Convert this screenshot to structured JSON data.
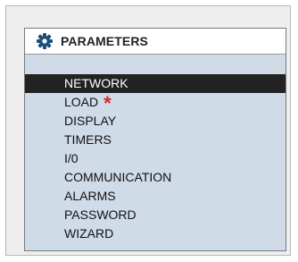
{
  "header": {
    "icon": "gear-icon",
    "title": "PARAMETERS"
  },
  "menu": {
    "items": [
      {
        "label": "NETWORK",
        "selected": true
      },
      {
        "label": "LOAD",
        "marker": "*"
      },
      {
        "label": "DISPLAY"
      },
      {
        "label": "TIMERS"
      },
      {
        "label": "I/0"
      },
      {
        "label": "COMMUNICATION"
      },
      {
        "label": "ALARMS"
      },
      {
        "label": "PASSWORD"
      },
      {
        "label": "WIZARD"
      }
    ]
  },
  "colors": {
    "panel_bg": "#cfdbe7",
    "selected_bg": "#222222",
    "marker": "#d42a2a",
    "icon": "#1f4f78"
  }
}
